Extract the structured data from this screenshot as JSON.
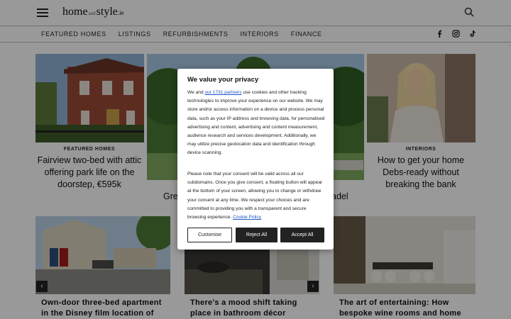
{
  "header": {
    "logo": {
      "home": "home",
      "and": "and",
      "style": "style",
      "ie": ".ie"
    }
  },
  "nav": {
    "items": [
      "FEATURED HOMES",
      "LISTINGS",
      "REFURBISHMENTS",
      "INTERIORS",
      "FINANCE"
    ],
    "social": [
      "facebook-icon",
      "instagram-icon",
      "tiktok-icon"
    ]
  },
  "cards": {
    "left": {
      "category": "FEATURED HOMES",
      "title": "Fairview two-bed with attic offering park life on the doorstep, €595k"
    },
    "center": {
      "title_left": "Gree",
      "title_right": "adel"
    },
    "right": {
      "category": "INTERIORS",
      "title": "How to get your home Debs-ready without breaking the bank"
    },
    "bottom": [
      {
        "title": "Own-door three-bed apartment in the Disney film location of"
      },
      {
        "title": "There's a mood shift taking place in bathroom décor"
      },
      {
        "title": "The art of entertaining: How bespoke wine rooms and home bars elevate"
      }
    ]
  },
  "consent": {
    "heading": "We value your privacy",
    "p1_before": "We and ",
    "p1_link": "our 1731 partners",
    "p1_after": " use cookies and other tracking technologies to improve your experience on our website. We may store and/or access information on a device and process personal data, such as your IP address and browsing data, for personalised advertising and content, advertising and content measurement, audience research and services development. Additionally, we may utilize precise geolocation data and identification through device scanning.",
    "p2_before": "Please note that your consent will be valid across all our subdomains. Once you give consent, a floating button will appear at the bottom of your screen, allowing you to change or withdraw your consent at any time. We respect your choices and are committed to providing you with a transparent and secure browsing experience. ",
    "p2_link": "Cookie Policy",
    "buttons": {
      "customise": "Customise",
      "reject": "Reject All",
      "accept": "Accept All"
    }
  }
}
